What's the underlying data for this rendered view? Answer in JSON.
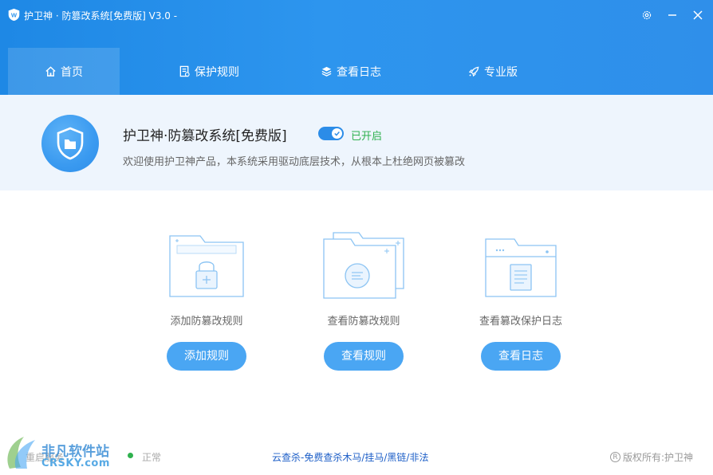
{
  "window": {
    "title": "护卫神 · 防篡改系统[免费版] V3.0 -",
    "settings_icon": "gear-icon",
    "minimize_icon": "minimize-icon",
    "close_icon": "close-icon"
  },
  "tabs": [
    {
      "label": "首页",
      "icon": "home-icon",
      "active": true
    },
    {
      "label": "保护规则",
      "icon": "rules-icon",
      "active": false
    },
    {
      "label": "查看日志",
      "icon": "layers-icon",
      "active": false
    },
    {
      "label": "专业版",
      "icon": "rocket-icon",
      "active": false
    }
  ],
  "status": {
    "product_name": "护卫神·防篡改系统[免费版]",
    "toggle_on": true,
    "toggle_label": "已开启",
    "description": "欢迎使用护卫神产品，本系统采用驱动底层技术，从根本上杜绝网页被篡改"
  },
  "features": [
    {
      "caption": "添加防篡改规则",
      "button": "添加规则",
      "icon": "folder-lock-icon"
    },
    {
      "caption": "查看防篡改规则",
      "button": "查看规则",
      "icon": "folders-search-icon"
    },
    {
      "caption": "查看篡改保护日志",
      "button": "查看日志",
      "icon": "document-log-icon"
    }
  ],
  "footer": {
    "left_text": "重启服务",
    "status_text": "正常",
    "link_text": "云查杀-免费查杀木马/挂马/黑链/非法",
    "copyright": "版权所有:护卫神",
    "copyright_symbol": "R"
  },
  "watermark": {
    "cn": "非凡软件站",
    "en": "CRSKY.com"
  },
  "colors": {
    "header": "#2d95ee",
    "accent": "#4aa6f3",
    "status_bg": "#eef5fd",
    "enabled_green": "#2fb14e",
    "link": "#1c5ec7"
  }
}
